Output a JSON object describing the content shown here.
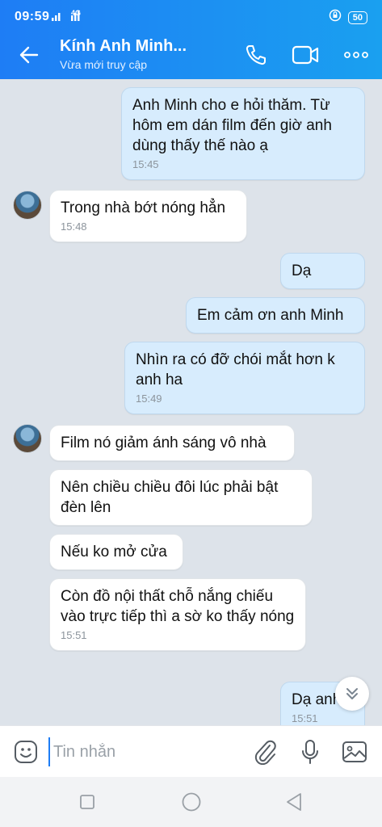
{
  "status_bar": {
    "time": "09:59",
    "network": "4G",
    "battery": "50"
  },
  "header": {
    "contact_name": "Kính Anh Minh...",
    "contact_status": "Vừa mới truy cập"
  },
  "messages": [
    {
      "side": "sent",
      "text": "Anh Minh cho e hỏi thăm. Từ hôm em dán film đến giờ anh dùng thấy thế nào ạ",
      "time": "15:45"
    },
    {
      "side": "recv",
      "text": "Trong nhà bớt nóng hẳn",
      "time": "15:48"
    },
    {
      "side": "sent",
      "text": "Dạ",
      "time": ""
    },
    {
      "side": "sent",
      "text": "Em cảm ơn anh Minh",
      "time": ""
    },
    {
      "side": "sent",
      "text": "Nhìn ra có đỡ chói mắt hơn k anh ha",
      "time": "15:49"
    },
    {
      "side": "recv",
      "text": "Film nó giảm ánh sáng vô nhà",
      "time": ""
    },
    {
      "side": "recv",
      "text": "Nên chiều chiều đôi lúc phải bật đèn lên",
      "time": ""
    },
    {
      "side": "recv",
      "text": "Nếu ko mở cửa",
      "time": ""
    },
    {
      "side": "recv",
      "text": "Còn đồ nội thất chỗ nắng chiếu vào trực tiếp thì a sờ ko thấy nóng",
      "time": "15:51"
    },
    {
      "side": "sent",
      "text": "Dạ anh",
      "time": "15:51"
    }
  ],
  "input": {
    "placeholder": "Tin nhắn"
  },
  "icons": {
    "back": "arrow-left-icon",
    "call": "phone-icon",
    "video": "video-camera-icon",
    "more": "more-dots-icon",
    "sticker": "sticker-smile-icon",
    "attach": "paperclip-icon",
    "mic": "microphone-icon",
    "image": "image-icon",
    "scroll": "chevron-double-down-icon"
  },
  "colors": {
    "header_start": "#1e7df5",
    "header_end": "#1aa0f0",
    "sent_bubble": "#d7ecfd",
    "recv_bubble": "#ffffff",
    "background": "#dde3ea"
  }
}
